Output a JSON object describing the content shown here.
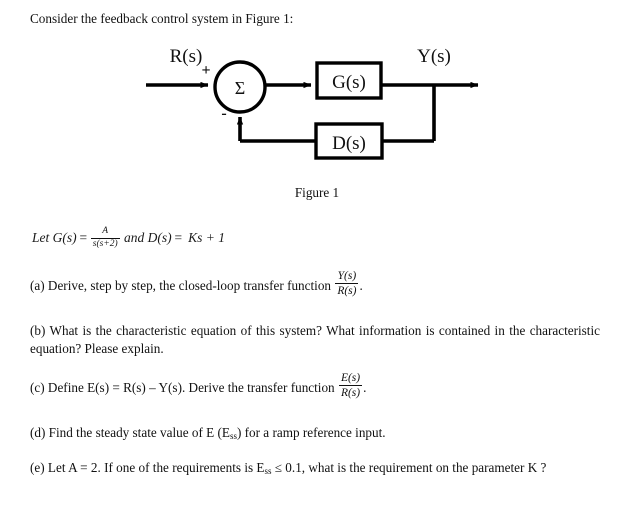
{
  "document": {
    "intro": "Consider the feedback control system in Figure 1:",
    "figure_caption": "Figure 1"
  },
  "diagram": {
    "name": "feedback-control-block-diagram",
    "input_label": "R(s)",
    "output_label": "Y(s)",
    "summing_junction_symbol": "Σ",
    "plus_sign": "+",
    "minus_sign": "-",
    "forward_block_label": "G(s)",
    "feedback_block_label": "D(s)",
    "line_color": "#000000"
  },
  "definitions": {
    "prefix": "Let ",
    "g_name": "G(s)",
    "equals": "= ",
    "g_numerator": "A",
    "g_denominator": "s(s+2)",
    "conjunction": "and ",
    "d_name": "D(s)",
    "equals2": "= ",
    "d_expression": "Ks + 1"
  },
  "questions": {
    "a": {
      "text_before": "(a) Derive, step by step, the closed-loop transfer function ",
      "frac_num": "Y(s)",
      "frac_den": "R(s)",
      "text_after": "."
    },
    "b": {
      "text": "(b) What is the characteristic equation of this system? What information is contained in the characteristic equation? Please explain."
    },
    "c": {
      "text_before": "(c) Define E(s) = R(s) – Y(s). Derive the transfer function ",
      "frac_num": "E(s)",
      "frac_den": "R(s)",
      "text_after": "."
    },
    "d": {
      "text_before": "(d) Find the steady state value of E (E",
      "subscript": "ss",
      "text_after": ") for a ramp reference input."
    },
    "e": {
      "text_before": "(e) Let A = 2. If one of the requirements is E",
      "subscript": "ss",
      "text_after": " ≤ 0.1, what is the requirement on the parameter K ?"
    }
  }
}
